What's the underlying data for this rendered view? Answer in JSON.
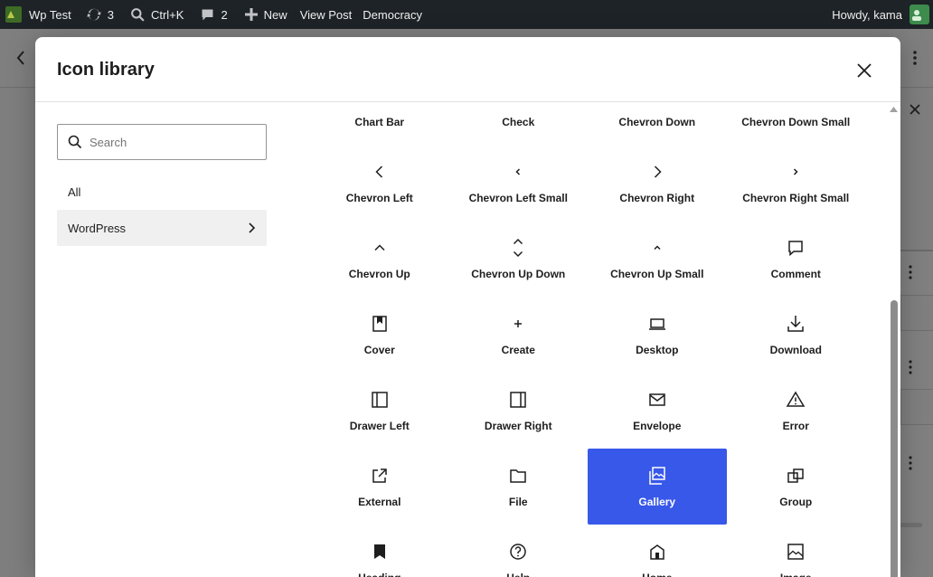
{
  "admin_bar": {
    "site_name": "Wp Test",
    "updates_count": "3",
    "search_shortcut": "Ctrl+K",
    "comments_count": "2",
    "new_label": "New",
    "view_post_label": "View Post",
    "democracy_label": "Democracy",
    "howdy": "Howdy, kama"
  },
  "modal": {
    "title": "Icon library",
    "search_placeholder": "Search",
    "categories": [
      {
        "label": "All",
        "selected": false
      },
      {
        "label": "WordPress",
        "selected": true
      }
    ],
    "icons": [
      {
        "name": "chart-bar",
        "label": "Chart Bar"
      },
      {
        "name": "check",
        "label": "Check"
      },
      {
        "name": "chevron-down",
        "label": "Chevron Down"
      },
      {
        "name": "chevron-down-small",
        "label": "Chevron Down Small"
      },
      {
        "name": "chevron-left",
        "label": "Chevron Left"
      },
      {
        "name": "chevron-left-small",
        "label": "Chevron Left Small"
      },
      {
        "name": "chevron-right",
        "label": "Chevron Right"
      },
      {
        "name": "chevron-right-small",
        "label": "Chevron Right Small"
      },
      {
        "name": "chevron-up",
        "label": "Chevron Up"
      },
      {
        "name": "chevron-up-down",
        "label": "Chevron Up Down"
      },
      {
        "name": "chevron-up-small",
        "label": "Chevron Up Small"
      },
      {
        "name": "comment",
        "label": "Comment"
      },
      {
        "name": "cover",
        "label": "Cover"
      },
      {
        "name": "create",
        "label": "Create"
      },
      {
        "name": "desktop",
        "label": "Desktop"
      },
      {
        "name": "download",
        "label": "Download"
      },
      {
        "name": "drawer-left",
        "label": "Drawer Left"
      },
      {
        "name": "drawer-right",
        "label": "Drawer Right"
      },
      {
        "name": "envelope",
        "label": "Envelope"
      },
      {
        "name": "error",
        "label": "Error"
      },
      {
        "name": "external",
        "label": "External"
      },
      {
        "name": "file",
        "label": "File"
      },
      {
        "name": "gallery",
        "label": "Gallery",
        "selected": true
      },
      {
        "name": "group",
        "label": "Group"
      },
      {
        "name": "heading",
        "label": "Heading"
      },
      {
        "name": "help",
        "label": "Help"
      },
      {
        "name": "home",
        "label": "Home"
      },
      {
        "name": "image",
        "label": "Image"
      }
    ]
  },
  "colors": {
    "accent": "#3858e9",
    "admin_bar": "#1d2327",
    "selected_category_bg": "#f0f0f0"
  }
}
